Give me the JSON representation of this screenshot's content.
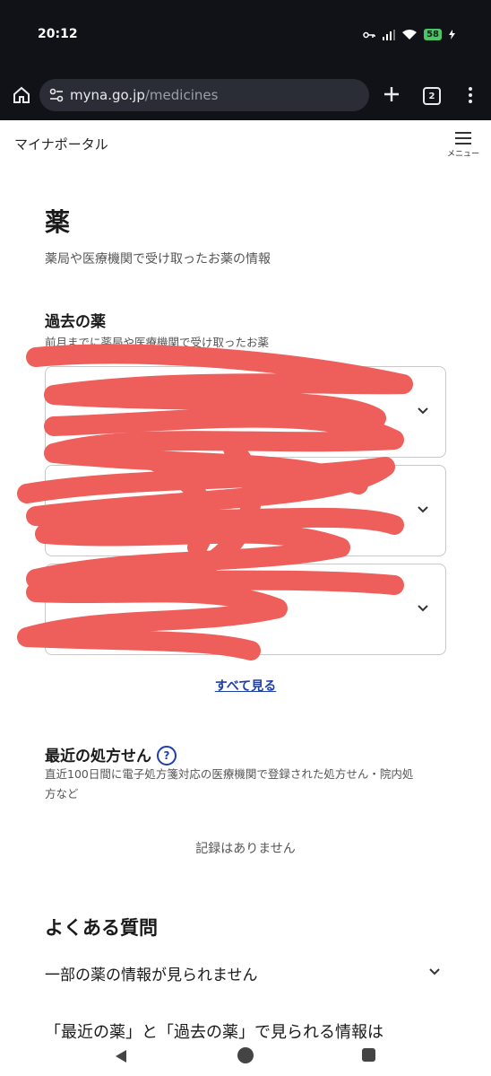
{
  "status_bar": {
    "time": "20:12",
    "battery": "58"
  },
  "browser": {
    "url_host": "myna.go.jp",
    "url_path": "/medicines",
    "tab_count": "2"
  },
  "site": {
    "title": "マイナポータル",
    "menu_label": "メニュー"
  },
  "page": {
    "title": "薬",
    "subtitle": "薬局や医療機関で受け取ったお薬の情報"
  },
  "past_medicines": {
    "title": "過去の薬",
    "description": "前月までに薬局や医療機関で受け取ったお薬",
    "see_all": "すべて見る"
  },
  "recent_prescriptions": {
    "title": "最近の処方せん",
    "help_glyph": "?",
    "description_line1": "直近100日間に電子処方箋対応の医療機関で登録された処方せん・院内処",
    "description_line2": "方など",
    "empty": "記録はありません"
  },
  "faq": {
    "title": "よくある質問",
    "items": [
      {
        "label": "一部の薬の情報が見られません"
      },
      {
        "label": "「最近の薬」と「過去の薬」で見られる情報は"
      }
    ]
  },
  "colors": {
    "link": "#1f3fa8",
    "redaction": "#ee5f5b",
    "chrome_bg": "#101218"
  }
}
